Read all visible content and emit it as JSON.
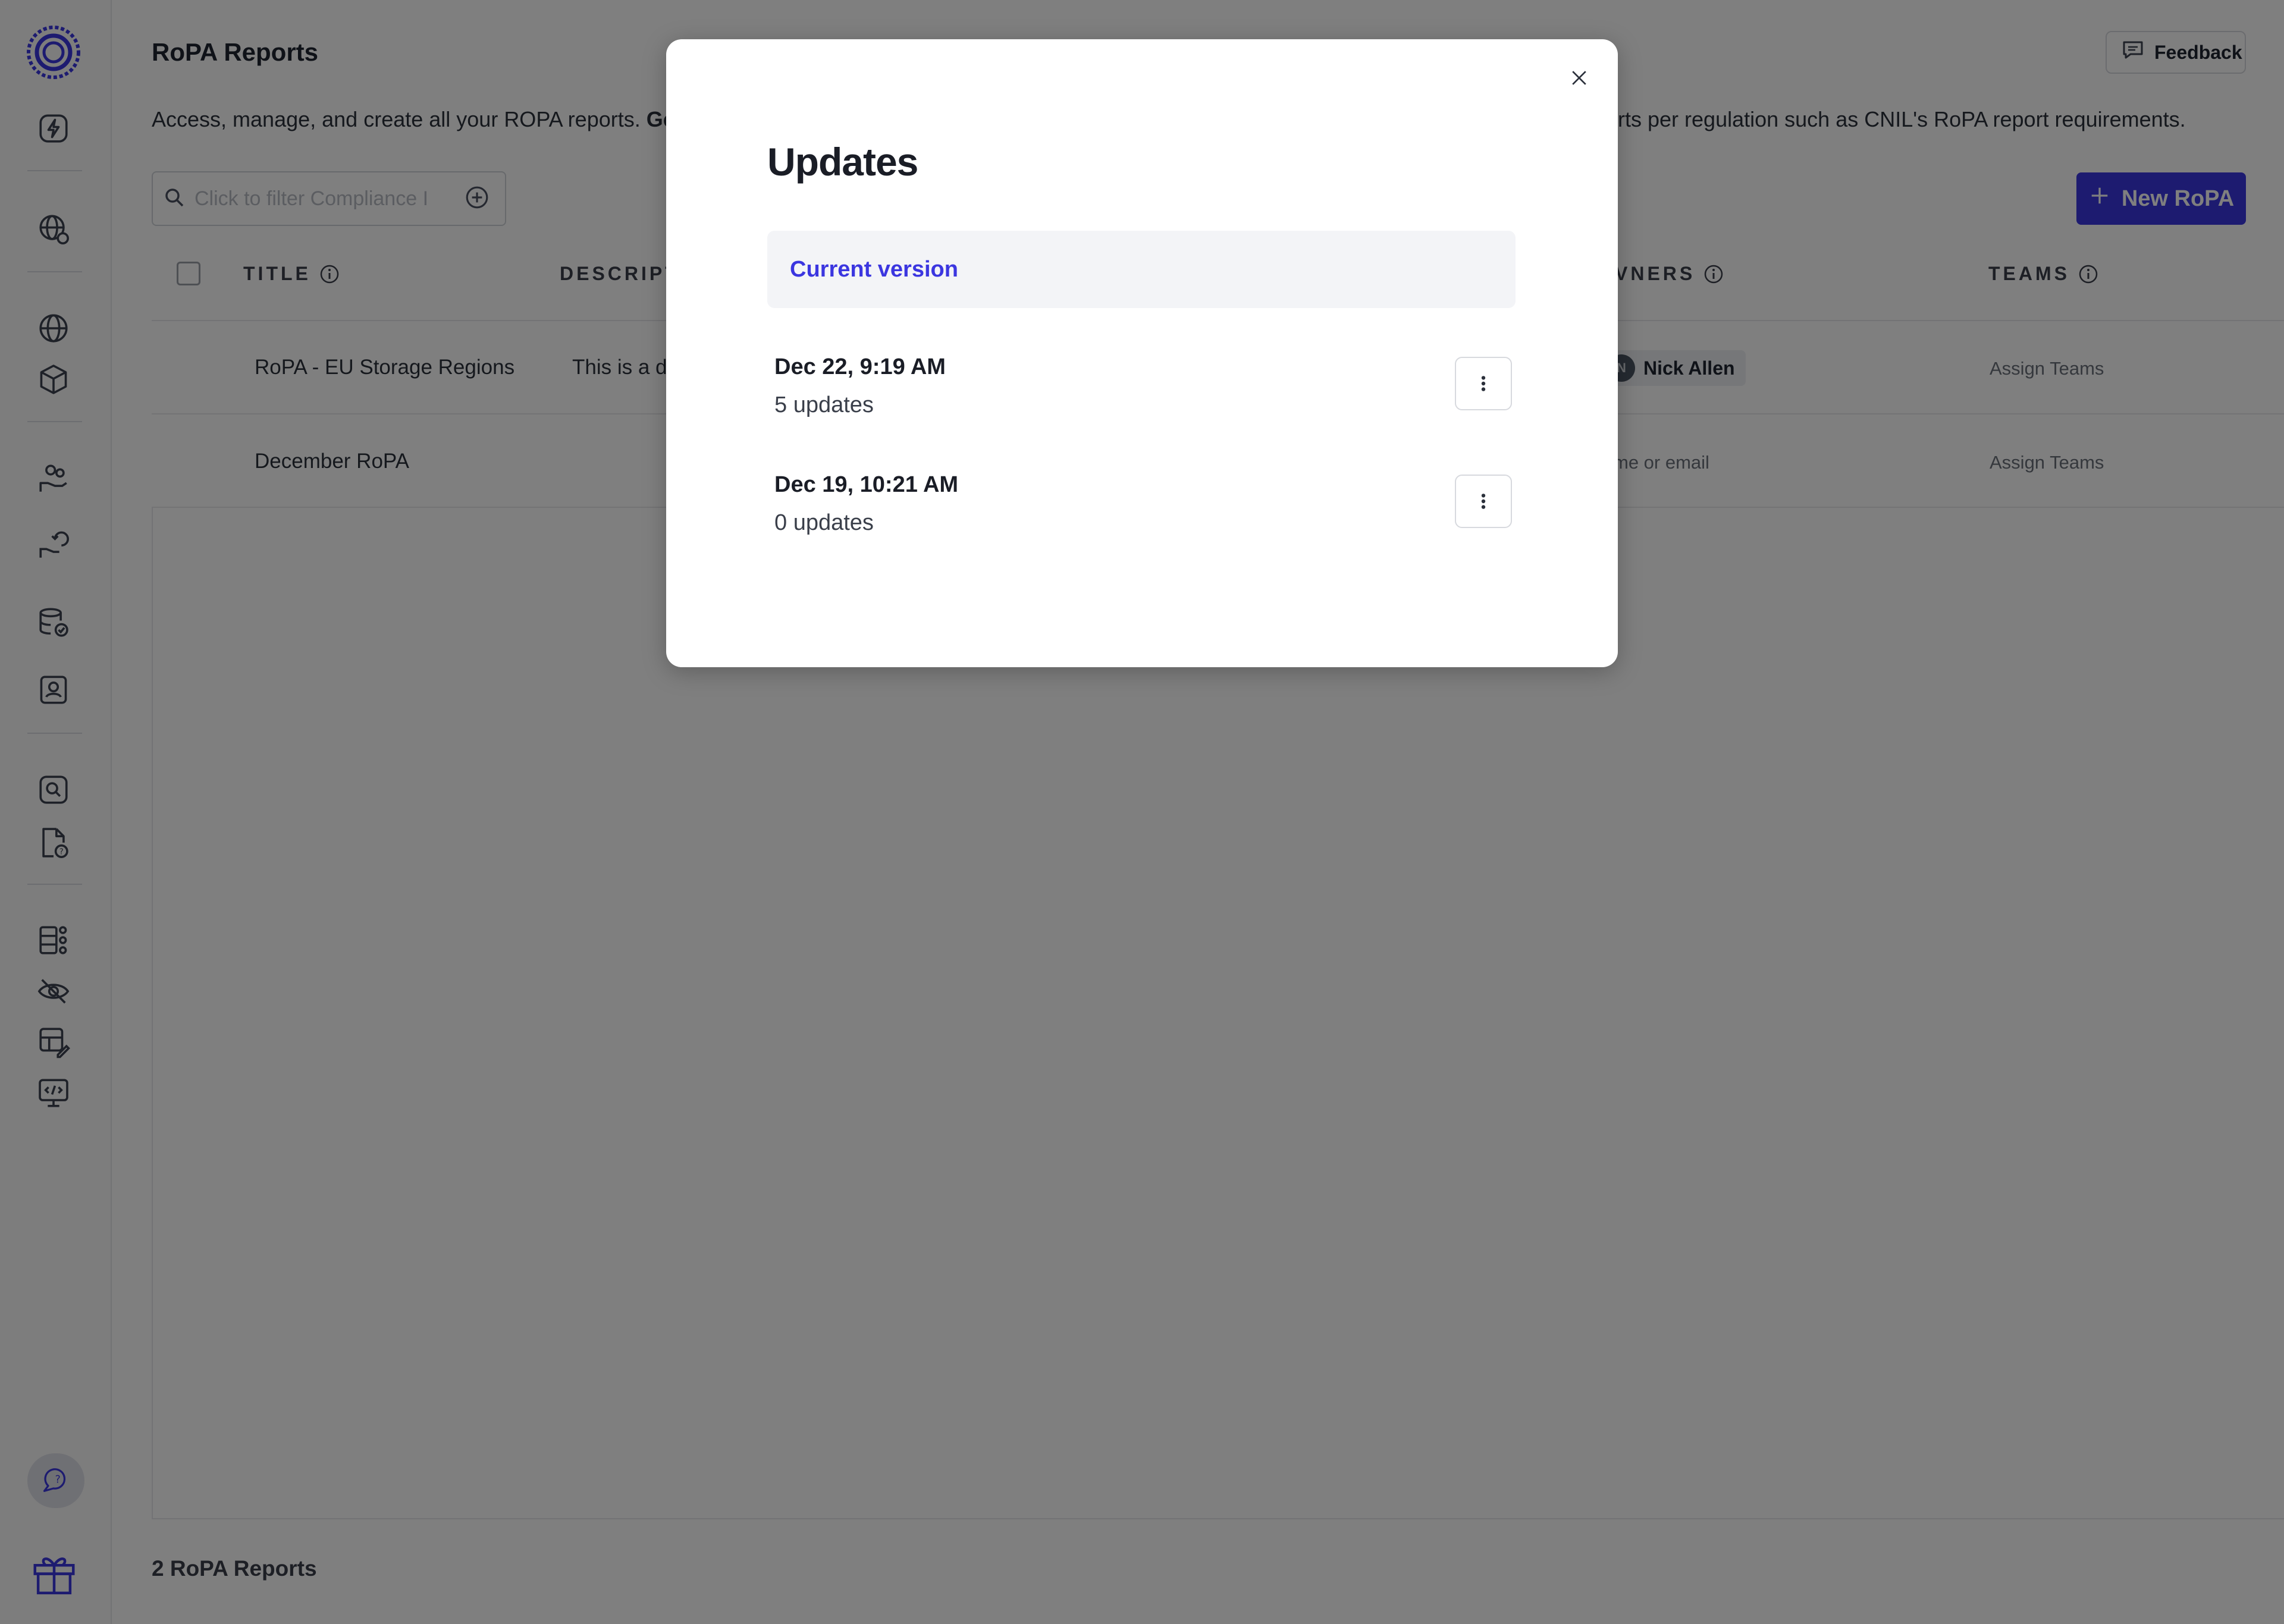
{
  "colors": {
    "accent": "#3b36e0",
    "overlay": "rgba(0,0,0,0.5)",
    "sidebar_bg": "#fafafb"
  },
  "sidebar": {
    "logo": "app-logo",
    "items": [
      {
        "name": "home-bolt-icon"
      },
      {
        "name": "globe-settings-icon"
      },
      {
        "name": "globe-icon"
      },
      {
        "name": "cube-icon"
      },
      {
        "name": "people-hand-icon"
      },
      {
        "name": "hand-refresh-icon"
      },
      {
        "name": "database-check-icon"
      },
      {
        "name": "contact-card-icon"
      },
      {
        "name": "scan-search-icon"
      },
      {
        "name": "file-question-icon"
      },
      {
        "name": "building-grid-icon"
      },
      {
        "name": "eye-off-icon"
      },
      {
        "name": "layout-edit-icon"
      },
      {
        "name": "monitor-code-icon"
      }
    ],
    "help": "help-chat-icon",
    "gift": "gift-icon"
  },
  "header": {
    "title": "RoPA Reports",
    "feedback_label": "Feedback"
  },
  "intro": {
    "text": "Access, manage, and create all your ROPA reports. ",
    "bold": "Gen",
    "tail": "orts per regulation such as CNIL's RoPA report requirements."
  },
  "filter": {
    "placeholder": "Click to filter Compliance I"
  },
  "new_button": {
    "label": "New RoPA"
  },
  "table": {
    "headers": {
      "title": "TITLE",
      "description": "DESCRIPT",
      "owners": "VNERS",
      "teams": "TEAMS"
    },
    "rows": [
      {
        "title": "RoPA - EU Storage Regions",
        "description": "This is a de",
        "owner": "Nick Allen",
        "owner_initial": "N",
        "teams": "Assign Teams"
      },
      {
        "title": "December RoPA",
        "description": "",
        "owner_placeholder": "me or email",
        "teams": "Assign Teams"
      }
    ]
  },
  "footer": {
    "count": "2 RoPA Reports"
  },
  "modal": {
    "title": "Updates",
    "current_version": "Current version",
    "versions": [
      {
        "date": "Dec 22, 9:19 AM",
        "count": "5 updates"
      },
      {
        "date": "Dec 19, 10:21 AM",
        "count": "0 updates"
      }
    ]
  }
}
